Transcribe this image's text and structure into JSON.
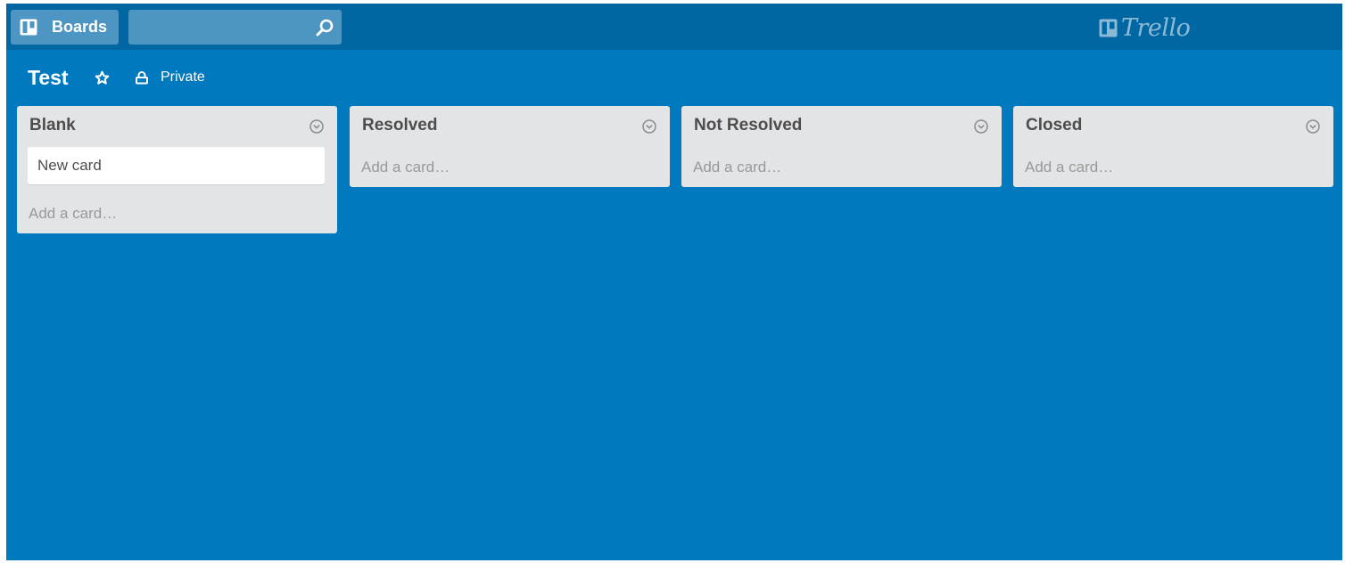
{
  "header": {
    "boards_button_label": "Boards",
    "search": {
      "value": "",
      "placeholder": ""
    },
    "logo_text": "Trello"
  },
  "board": {
    "title": "Test",
    "starred": false,
    "privacy_label": "Private"
  },
  "lists": [
    {
      "title": "Blank",
      "cards": [
        {
          "title": "New card"
        }
      ],
      "add_card_label": "Add a card…"
    },
    {
      "title": "Resolved",
      "cards": [],
      "add_card_label": "Add a card…"
    },
    {
      "title": "Not Resolved",
      "cards": [],
      "add_card_label": "Add a card…"
    },
    {
      "title": "Closed",
      "cards": [],
      "add_card_label": "Add a card…"
    }
  ],
  "colors": {
    "header_bg": "#0067a3",
    "board_bg": "#0079bf",
    "list_bg": "#e2e4e6",
    "card_bg": "#ffffff"
  },
  "icons": {
    "boards": "boards-icon",
    "search": "search-icon",
    "logo": "trello-logo-icon",
    "star": "star-icon",
    "privacy": "lock-icon",
    "list_menu": "chevron-down-circle-icon"
  }
}
